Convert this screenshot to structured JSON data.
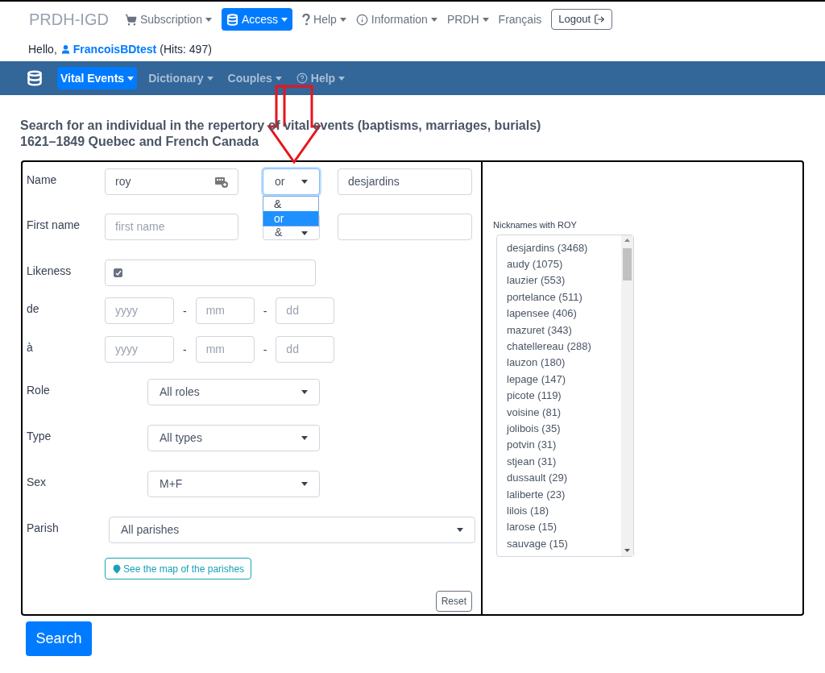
{
  "top_nav": {
    "brand": "PRDH-IGD",
    "items": [
      {
        "label": "Subscription",
        "kind": "dropdown",
        "selected": false
      },
      {
        "label": "Access",
        "kind": "dropdown",
        "selected": true
      },
      {
        "label": "Help",
        "kind": "dropdown",
        "selected": false
      },
      {
        "label": "Information",
        "kind": "dropdown",
        "selected": false
      },
      {
        "label": "PRDH",
        "kind": "dropdown",
        "selected": false
      },
      {
        "label": "Français",
        "kind": "link"
      },
      {
        "label": "Logout",
        "kind": "button"
      }
    ]
  },
  "greeting": {
    "prefix": "Hello,",
    "user": "FrancoisBDtest",
    "hits": "(Hits: 497)"
  },
  "sub_nav": {
    "items": [
      {
        "label": "Vital Events",
        "selected": true
      },
      {
        "label": "Dictionary",
        "selected": false
      },
      {
        "label": "Couples",
        "selected": false
      },
      {
        "label": "Help",
        "selected": false
      }
    ]
  },
  "heading": [
    "Search for an individual in the repertory of vital events (baptisms, marriages, burials)",
    "1621–1849 Quebec and French Canada"
  ],
  "form": {
    "name": {
      "label": "Name",
      "value": "roy",
      "operator": "or",
      "operator_menu": [
        {
          "label": "&",
          "selected": false
        },
        {
          "label": "or",
          "selected": true
        }
      ],
      "nickname": "desjardins"
    },
    "first_name": {
      "label": "First name",
      "placeholder": "first name",
      "operator": "&"
    },
    "likeness": {
      "label": "Likeness",
      "checked": true
    },
    "dates": [
      {
        "label": "de",
        "year": "yyyy",
        "month": "mm",
        "day": "dd",
        "separator": "-"
      },
      {
        "label": "à",
        "year": "yyyy",
        "month": "mm",
        "day": "dd",
        "separator": "-"
      }
    ],
    "selects": [
      {
        "label": "Role",
        "value": "All roles"
      },
      {
        "label": "Type",
        "value": "All types"
      },
      {
        "label": "Sex",
        "value": "M+F"
      }
    ],
    "parish": {
      "label": "Parish",
      "value": "All parishes"
    },
    "map_button": "See the map of the parishes",
    "reset": "Reset"
  },
  "nicknames": {
    "title": "Nicknames with ROY",
    "items": [
      "desjardins (3468)",
      "audy (1075)",
      "lauzier (553)",
      "portelance (511)",
      "lapensee (406)",
      "mazuret (343)",
      "chatellereau (288)",
      "lauzon (180)",
      "lepage (147)",
      "picote (119)",
      "voisine (81)",
      "jolibois (35)",
      "potvin (31)",
      "stjean (31)",
      "dussault (29)",
      "laliberte (23)",
      "lilois (18)",
      "larose (15)",
      "sauvage (15)"
    ]
  },
  "search_button": "Search"
}
